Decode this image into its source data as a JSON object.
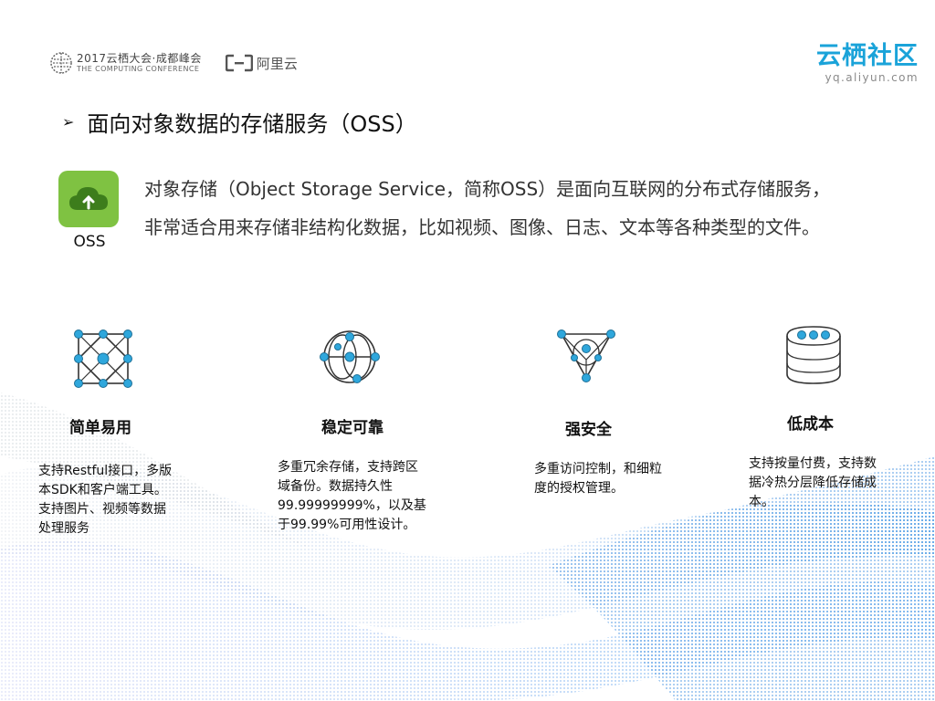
{
  "header": {
    "conference_line1": "2017云栖大会·成都峰会",
    "conference_line2": "THE COMPUTING CONFERENCE",
    "aliyun_name": "阿里云",
    "brand_name": "云栖社区",
    "brand_url": "yq.aliyun.com"
  },
  "section": {
    "bullet": "➢",
    "title": "面向对象数据的存储服务（OSS）"
  },
  "oss": {
    "label": "OSS",
    "description_line1": "对象存储（Object Storage Service，简称OSS）是面向互联网的分布式存储服务，",
    "description_line2": "非常适合用来存储非结构化数据，比如视频、图像、日志、文本等各种类型的文件。"
  },
  "features": [
    {
      "title": "简单易用",
      "icon": "grid-network-icon",
      "desc_lines": [
        "支持Restful接口，多版",
        "本SDK和客户端工具。",
        "支持图片、视频等数据",
        "处理服务"
      ]
    },
    {
      "title": "稳定可靠",
      "icon": "orbit-circles-icon",
      "desc_lines": [
        "多重冗余存储，支持跨区",
        "域备份。数据持久性",
        "99.99999999%，以及基",
        "于99.99%可用性设计。"
      ]
    },
    {
      "title": "强安全",
      "icon": "triangle-shield-icon",
      "desc_lines": [
        "多重访问控制，和细粒",
        "度的授权管理。"
      ]
    },
    {
      "title": "低成本",
      "icon": "database-stack-icon",
      "desc_lines": [
        "支持按量付费，支持数",
        "据冷热分层降低存储成",
        "本。"
      ]
    }
  ],
  "colors": {
    "brand_blue": "#1aa3d9",
    "node_blue": "#2fa7dc",
    "oss_green": "#7fc242"
  }
}
